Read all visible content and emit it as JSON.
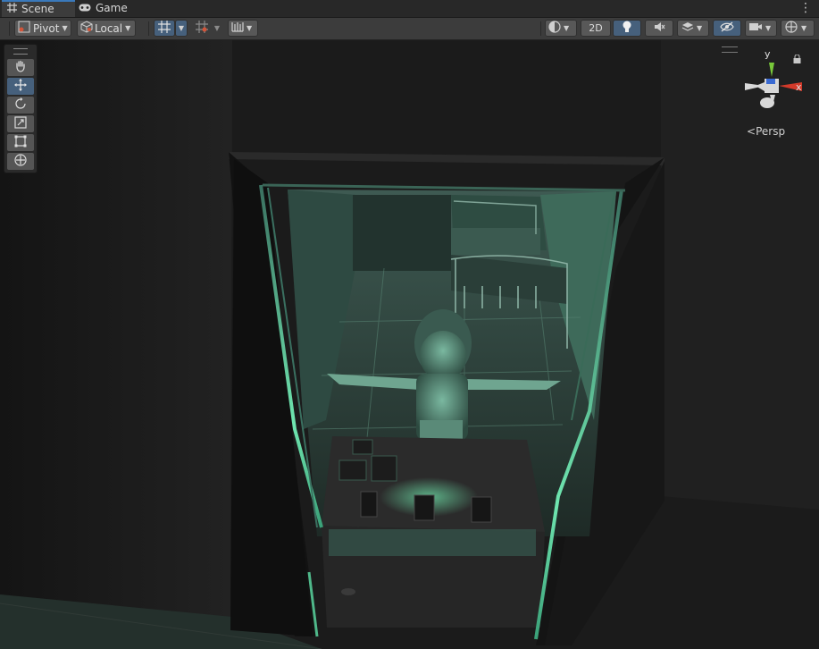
{
  "tabs": [
    {
      "label": "Scene",
      "icon": "hash-grid-icon",
      "active": true
    },
    {
      "label": "Game",
      "icon": "gamepad-icon",
      "active": false
    }
  ],
  "toolbar": {
    "pivot_label": "Pivot",
    "local_label": "Local",
    "mode_2d_label": "2D"
  },
  "gizmo": {
    "y_label": "y",
    "x_label": "x",
    "view_label": "Persp"
  },
  "colors": {
    "accent": "#46607c",
    "glow": "#5fd49a",
    "axis_x": "#d23a2a",
    "axis_y": "#78c83a",
    "axis_z": "#3a6ad2"
  }
}
